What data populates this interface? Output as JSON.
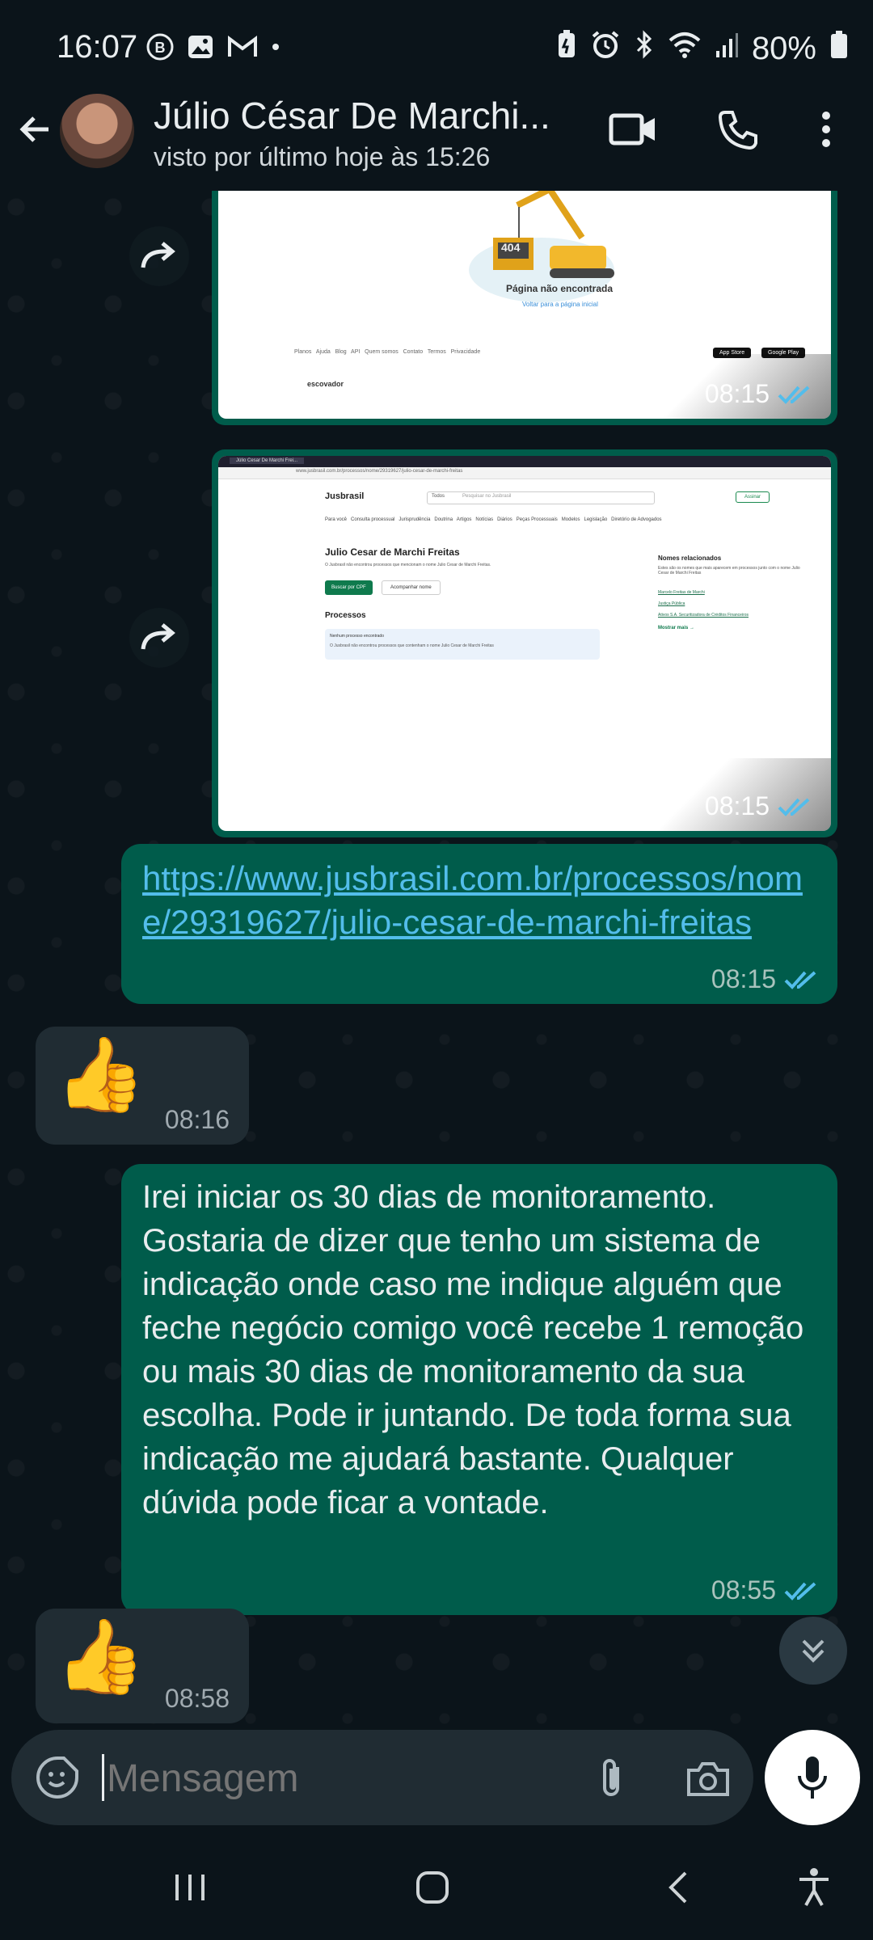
{
  "status_bar": {
    "time": "16:07",
    "battery": "80%",
    "left_icons": [
      "b-circle-icon",
      "gallery-icon",
      "gmail-icon",
      "dot-icon"
    ],
    "right_icons": [
      "battery-saver-icon",
      "alarm-icon",
      "bluetooth-icon",
      "wifi-icon",
      "signal-icon",
      "battery-icon"
    ]
  },
  "header": {
    "contact_name": "Júlio César De Marchi...",
    "last_seen": "visto por último hoje às 15:26"
  },
  "messages": {
    "img1": {
      "time": "08:15",
      "page_title": "Página não encontrada",
      "page_sub": "Voltar para a página inicial",
      "error_code": "404",
      "footer_links": "Planos   Ajuda   Blog   API   Quem somos   Contato   Termos   Privacidade",
      "brand": "escovador",
      "appstore": "App Store",
      "googleplay": "Google Play"
    },
    "img2": {
      "time": "08:15",
      "browser_tab": "Júlio Cesar De Marchi Frei...",
      "url": "www.jusbrasil.com.br/processos/nome/29319627/julio-cesar-de-marchi-freitas",
      "logo": "Jusbrasil",
      "search_select": "Todos",
      "search_placeholder": "Pesquisar no Jusbrasil",
      "cta": "Assinar",
      "nav": "Para você   Consulta processual   Jurisprudência   Doutrina   Artigos   Notícias   Diários   Peças Processuais   Modelos   Legislação   Diretório de Advogados",
      "person_name": "Julio Cesar de Marchi Freitas",
      "person_sub": "O Jusbrasil não encontrou processos que mencionam o nome Julio Cesar de Marchi Freitas.",
      "btn_cpf": "Buscar por CPF",
      "btn_follow": "Acompanhar nome",
      "section": "Processos",
      "notice_title": "Nenhum processo encontrado",
      "notice_text": "O Jusbrasil não encontrou processos que contenham o nome Julio Cesar de Marchi Freitas",
      "related_title": "Nomes relacionados",
      "related_sub": "Estes são os nomes que mais aparecem em processos junto com o nome Julio Cesar de Marchi Freitas",
      "related_1": "Marcelo Freitas de Marchi",
      "related_2": "Justiça Pública",
      "related_3": "Ativos S.A. Securitizadora de Créditos Financeiros",
      "more": "Mostrar mais →"
    },
    "link_msg": {
      "text": "https://www.jusbrasil.com.br/processos/nome/29319627/julio-cesar-de-marchi-freitas",
      "time": "08:15"
    },
    "thumb1": {
      "emoji": "👍",
      "time": "08:16"
    },
    "long_msg": {
      "text": "Irei iniciar os 30 dias de monitoramento. Gostaria de dizer que tenho um sistema de indicação onde caso me indique alguém que feche negócio comigo você recebe 1 remoção ou mais 30 dias de monitoramento da sua escolha. Pode ir juntando. De toda forma  sua indicação me ajudará bastante. Qualquer dúvida pode ficar a vontade.",
      "time": "08:55"
    },
    "thumb2": {
      "emoji": "👍",
      "time": "08:58"
    }
  },
  "composer": {
    "placeholder": "Mensagem"
  },
  "colors": {
    "background": "#0b141a",
    "outgoing_bubble": "#005c4b",
    "incoming_bubble": "#202c33",
    "link": "#53bdeb",
    "read_ticks": "#53bdeb"
  }
}
